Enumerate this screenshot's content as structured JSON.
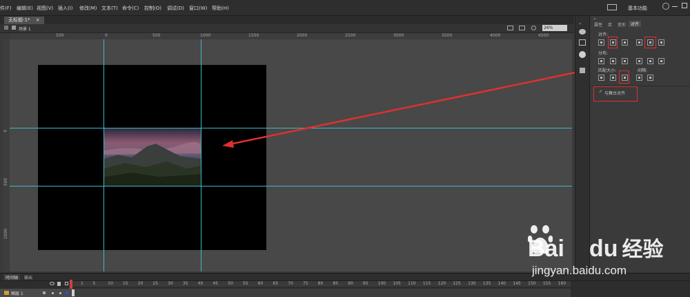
{
  "menubar": {
    "items": [
      "件(F)",
      "编辑(E)",
      "视图(V)",
      "插入(I)",
      "修改(M)",
      "文本(T)",
      "命令(C)",
      "控制(O)",
      "调试(D)",
      "窗口(W)",
      "帮助(H)"
    ],
    "workspace": "基本功能"
  },
  "document": {
    "tab_title": "无标题-1*",
    "close_glyph": "×",
    "scene_label": "场景 1",
    "zoom": "26%"
  },
  "rulers": {
    "h_labels": [
      "500",
      "0",
      "500",
      "1000",
      "1500",
      "2000",
      "2500",
      "3000",
      "3500",
      "4000",
      "4500"
    ],
    "v_labels": [
      "0",
      "500",
      "1000"
    ]
  },
  "panel": {
    "tabs": [
      "属性",
      "库",
      "变形",
      "对齐"
    ],
    "align_label": "对齐:",
    "distribute_label": "分布:",
    "match_size_label": "匹配大小:",
    "spacing_label": "间隔:",
    "align_to_stage": "与舞台对齐",
    "check_glyph": "✓"
  },
  "timeline": {
    "tabs": [
      "时间轴",
      "输出"
    ],
    "layer_name": "图层 1",
    "frame_numbers": [
      "1",
      "5",
      "10",
      "15",
      "20",
      "25",
      "30",
      "35",
      "40",
      "45",
      "50",
      "55",
      "60",
      "65",
      "70",
      "75",
      "80",
      "85",
      "90",
      "95",
      "100",
      "105",
      "110",
      "115",
      "120",
      "125",
      "130",
      "135",
      "140",
      "145",
      "150",
      "155",
      "160"
    ]
  },
  "watermark": {
    "brand_latin": "Bai",
    "brand_du": "du",
    "brand_cn": "经验",
    "url": "jingyan.baidu.com"
  },
  "colors": {
    "guide": "#3fb9c8",
    "annotation": "#e03030",
    "stage": "#000000"
  }
}
